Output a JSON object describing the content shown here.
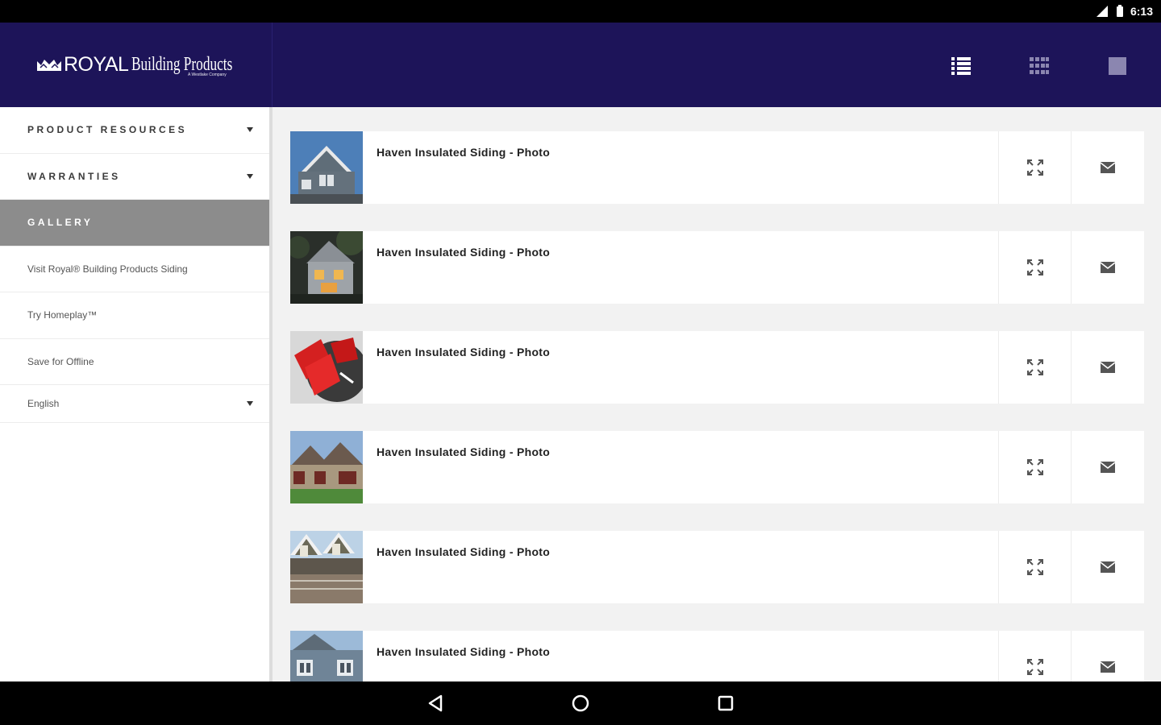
{
  "status_bar": {
    "time": "6:13"
  },
  "header": {
    "logo_brand": "ROYAL",
    "logo_sub": "Building Products",
    "logo_tagline": "A Westlake Company"
  },
  "sidebar": {
    "items": [
      {
        "label": "PRODUCT RESOURCES"
      },
      {
        "label": "WARRANTIES"
      },
      {
        "label": "GALLERY"
      },
      {
        "label": "Visit Royal® Building Products Siding"
      },
      {
        "label": "Try Homeplay™"
      },
      {
        "label": "Save for Offline"
      },
      {
        "label": "English"
      }
    ]
  },
  "gallery": {
    "items": [
      {
        "title": "Haven Insulated Siding - Photo"
      },
      {
        "title": "Haven Insulated Siding - Photo"
      },
      {
        "title": "Haven Insulated Siding - Photo"
      },
      {
        "title": "Haven Insulated Siding - Photo"
      },
      {
        "title": "Haven Insulated Siding - Photo"
      },
      {
        "title": "Haven Insulated Siding - Photo"
      }
    ]
  },
  "icons": {
    "list_view": "list-view-icon",
    "grid_view": "grid-view-icon",
    "square": "square-icon",
    "expand": "expand-icon",
    "email": "email-icon"
  },
  "colors": {
    "header_bg": "#1d1459",
    "active_nav_bg": "#8c8c8c",
    "main_bg": "#f2f2f2"
  }
}
